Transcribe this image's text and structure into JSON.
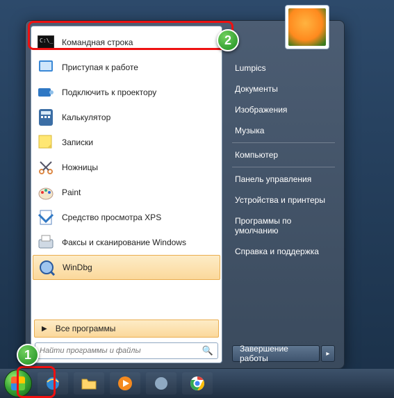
{
  "programs": [
    {
      "label": "Командная строка",
      "icon": "cmd"
    },
    {
      "label": "Приступая к работе",
      "icon": "getting-started"
    },
    {
      "label": "Подключить к проектору",
      "icon": "projector"
    },
    {
      "label": "Калькулятор",
      "icon": "calculator"
    },
    {
      "label": "Записки",
      "icon": "sticky-notes"
    },
    {
      "label": "Ножницы",
      "icon": "snipping"
    },
    {
      "label": "Paint",
      "icon": "paint"
    },
    {
      "label": "Средство просмотра XPS",
      "icon": "xps"
    },
    {
      "label": "Факсы и сканирование Windows",
      "icon": "fax"
    },
    {
      "label": "WinDbg",
      "icon": "windbg"
    }
  ],
  "all_programs_label": "Все программы",
  "search": {
    "placeholder": "Найти программы и файлы"
  },
  "user": {
    "name": "Lumpics"
  },
  "places": [
    "Документы",
    "Изображения",
    "Музыка"
  ],
  "system": [
    "Компьютер"
  ],
  "controls": [
    "Панель управления",
    "Устройства и принтеры",
    "Программы по умолчанию",
    "Справка и поддержка"
  ],
  "shutdown": {
    "label": "Завершение работы"
  },
  "badges": {
    "one": "1",
    "two": "2"
  }
}
